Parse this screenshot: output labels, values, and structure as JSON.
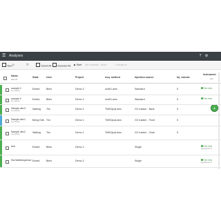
{
  "app": {
    "title": "Analyses"
  },
  "toolbar": {
    "new": "New",
    "select_all": "Select All",
    "deselect_all": "Deselect All",
    "start": "Start",
    "set_unready": "Set Unready",
    "abort": "Abort",
    "assign": "Assign to"
  },
  "columns": {
    "name": "Name",
    "name_sub": "Sam ID",
    "state": "State",
    "user": "User",
    "project": "Project",
    "method": "Acq. method",
    "source": "Injection source",
    "volume": "Inj. volume",
    "last": "Instrument",
    "last_sub": "Info"
  },
  "rows": [
    {
      "name": "sample 0",
      "sub": "sa_sample",
      "state": "Ended",
      "user": "Birks",
      "project": "Demo 2",
      "method": "sort01.ams",
      "source": "Standard",
      "volume": "5",
      "badge": "Data ready",
      "stripe": "#4caf50"
    },
    {
      "name": "sample 0",
      "sub": "sa_sample",
      "state": "Ended",
      "user": "Birks",
      "project": "Demo 2",
      "method": "sort01.ams",
      "source": "Standard",
      "volume": "5",
      "badge": "Data ready",
      "stripe": "#4caf50"
    },
    {
      "name": "Sample abc3",
      "sub": "sa_sample",
      "state": "Waiting",
      "user": "Tim",
      "project": "Demo 1",
      "method": "TIMSQual.ams",
      "source": "GC tracker - Back",
      "volume": "5",
      "badge": "",
      "stripe": "#4caf50"
    },
    {
      "name": "Sample abc1",
      "sub": "sa_sample",
      "state": "Being Edit...",
      "user": "Tim",
      "project": "Demo 1",
      "method": "TIMSQual.ams",
      "source": "GC tracker - Front",
      "volume": "5",
      "badge": "",
      "stripe": "#4fa8d8"
    },
    {
      "name": "Sample abc2",
      "sub": "sa_sample",
      "state": "Waiting",
      "user": "Tim",
      "project": "Demo 1",
      "method": "TIMSQual.ams",
      "source": "GC tracker - Chair",
      "volume": "5",
      "badge": "",
      "stripe": "#4caf50"
    },
    {
      "name": "test",
      "sub": "",
      "state": "Ended",
      "user": "Birks",
      "project": "Demo 2",
      "method": "",
      "source": "Single",
      "volume": "",
      "badge": "Data ready",
      "badge2": "Hypothesis: 0",
      "stripe": "#4caf50"
    },
    {
      "name": "SecValidsequence",
      "sub": "",
      "state": "Ended",
      "user": "Birks",
      "project": "Demo 2",
      "method": "",
      "source": "Single",
      "volume": "",
      "badge": "Data ready",
      "badge2": "Hypothesis: 0",
      "stripe": "#4caf50"
    }
  ]
}
